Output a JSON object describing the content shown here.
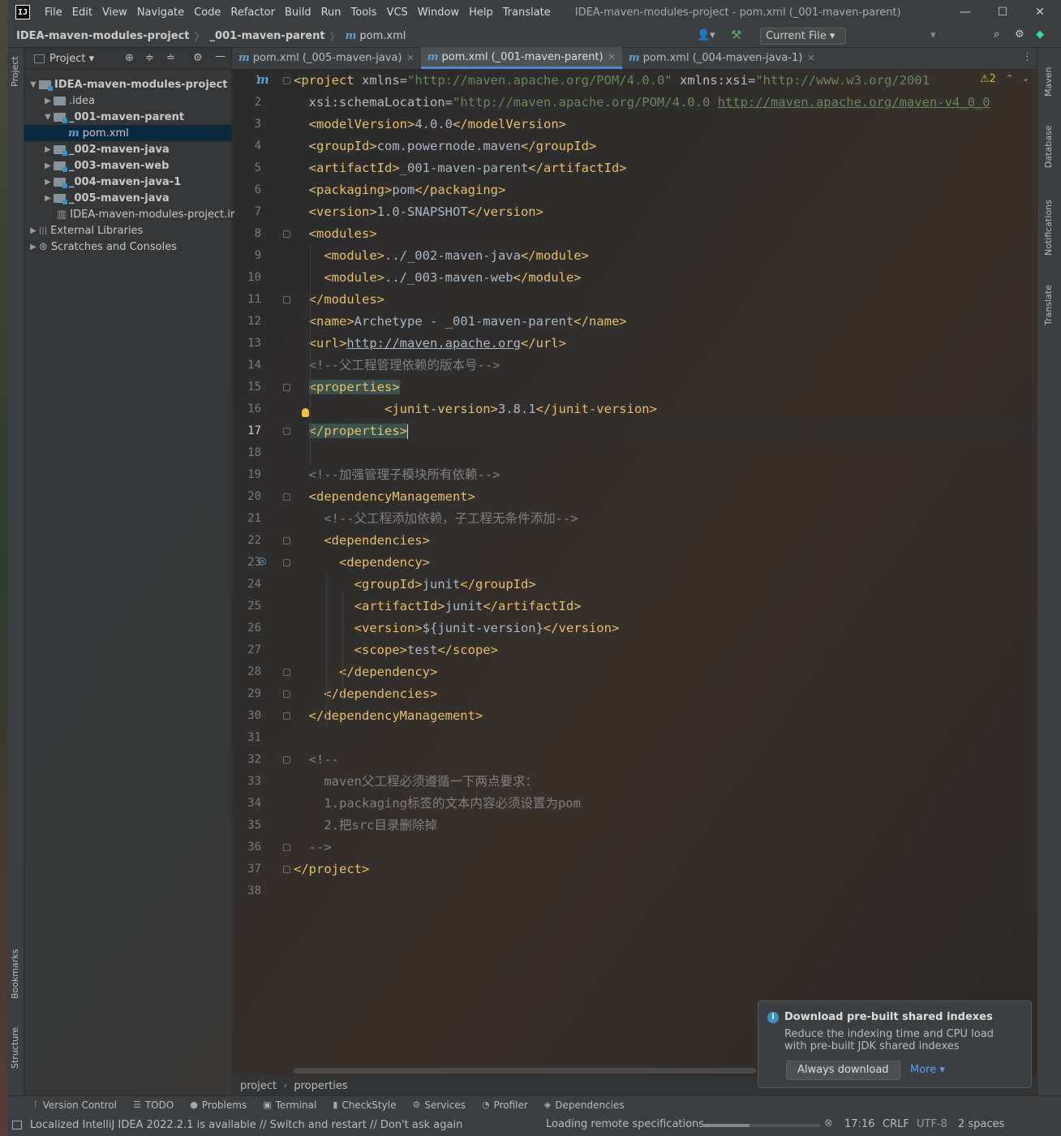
{
  "menu": {
    "items": [
      "File",
      "Edit",
      "View",
      "Navigate",
      "Code",
      "Refactor",
      "Build",
      "Run",
      "Tools",
      "VCS",
      "Window",
      "Help",
      "Translate"
    ],
    "title": "IDEA-maven-modules-project - pom.xml (_001-maven-parent)",
    "app_icon": "IJ"
  },
  "nav": {
    "project": "IDEA-maven-modules-project",
    "module": "_001-maven-parent",
    "file": "pom.xml",
    "run_config": "Current File ▾"
  },
  "project_panel": {
    "title": "Project ▾",
    "tree": [
      {
        "label": "IDEA-maven-modules-project",
        "indent": 0,
        "arrow": "open",
        "kind": "module",
        "bold": true
      },
      {
        "label": ".idea",
        "indent": 1,
        "arrow": "closed",
        "kind": "folder"
      },
      {
        "label": "_001-maven-parent",
        "indent": 1,
        "arrow": "open",
        "kind": "module",
        "bold": true
      },
      {
        "label": "pom.xml",
        "indent": 2,
        "arrow": "none",
        "kind": "maven",
        "selected": true
      },
      {
        "label": "_002-maven-java",
        "indent": 1,
        "arrow": "closed",
        "kind": "module",
        "bold": true
      },
      {
        "label": "_003-maven-web",
        "indent": 1,
        "arrow": "closed",
        "kind": "module",
        "bold": true
      },
      {
        "label": "_004-maven-java-1",
        "indent": 1,
        "arrow": "closed",
        "kind": "module",
        "bold": true
      },
      {
        "label": "_005-maven-java",
        "indent": 1,
        "arrow": "closed",
        "kind": "module",
        "bold": true
      },
      {
        "label": "IDEA-maven-modules-project.ir",
        "indent": 2,
        "arrow": "none",
        "kind": "file"
      },
      {
        "label": "External Libraries",
        "indent": 0,
        "arrow": "closed",
        "kind": "lib"
      },
      {
        "label": "Scratches and Consoles",
        "indent": 0,
        "arrow": "closed",
        "kind": "scratch"
      }
    ]
  },
  "tabs": [
    {
      "label": "pom.xml (_005-maven-java)",
      "active": false
    },
    {
      "label": "pom.xml (_001-maven-parent)",
      "active": true
    },
    {
      "label": "pom.xml (_004-maven-java-1)",
      "active": false
    }
  ],
  "editor": {
    "current_line": 17,
    "warnings": "⚠2",
    "lines": [
      [
        [
          "t",
          "<project "
        ],
        [
          "a",
          "xmlns"
        ],
        [
          "p",
          "="
        ],
        [
          "v",
          "\"http://maven.apache.org/POM/4.0.0\""
        ],
        [
          "p",
          " "
        ],
        [
          "a",
          "xmlns:xsi"
        ],
        [
          "p",
          "="
        ],
        [
          "v",
          "\"http://www.w3.org/2001"
        ]
      ],
      [
        [
          "p",
          "  "
        ],
        [
          "a",
          "xsi:schemaLocation"
        ],
        [
          "p",
          "="
        ],
        [
          "v",
          "\"http://maven.apache.org/POM/4.0.0 "
        ],
        [
          "u",
          "http://maven.apache.org/maven-v4_0_0"
        ]
      ],
      [
        [
          "p",
          "  "
        ],
        [
          "t",
          "<modelVersion>"
        ],
        [
          "p",
          "4.0.0"
        ],
        [
          "t",
          "</modelVersion>"
        ]
      ],
      [
        [
          "p",
          "  "
        ],
        [
          "t",
          "<groupId>"
        ],
        [
          "p",
          "com.powernode.maven"
        ],
        [
          "t",
          "</groupId>"
        ]
      ],
      [
        [
          "p",
          "  "
        ],
        [
          "t",
          "<artifactId>"
        ],
        [
          "p",
          "_001-maven-parent"
        ],
        [
          "t",
          "</artifactId>"
        ]
      ],
      [
        [
          "p",
          "  "
        ],
        [
          "t",
          "<packaging>"
        ],
        [
          "p",
          "pom"
        ],
        [
          "t",
          "</packaging>"
        ]
      ],
      [
        [
          "p",
          "  "
        ],
        [
          "t",
          "<version>"
        ],
        [
          "p",
          "1.0-SNAPSHOT"
        ],
        [
          "t",
          "</version>"
        ]
      ],
      [
        [
          "p",
          "  "
        ],
        [
          "t",
          "<modules>"
        ]
      ],
      [
        [
          "p",
          "    "
        ],
        [
          "t",
          "<module>"
        ],
        [
          "p",
          "../_002-maven-java"
        ],
        [
          "t",
          "</module>"
        ]
      ],
      [
        [
          "p",
          "    "
        ],
        [
          "t",
          "<module>"
        ],
        [
          "p",
          "../_003-maven-web"
        ],
        [
          "t",
          "</module>"
        ]
      ],
      [
        [
          "p",
          "  "
        ],
        [
          "t",
          "</modules>"
        ]
      ],
      [
        [
          "p",
          "  "
        ],
        [
          "t",
          "<name>"
        ],
        [
          "p",
          "Archetype - _001-maven-parent"
        ],
        [
          "t",
          "</name>"
        ]
      ],
      [
        [
          "p",
          "  "
        ],
        [
          "t",
          "<url>"
        ],
        [
          "l",
          "http://maven.apache.org"
        ],
        [
          "t",
          "</url>"
        ]
      ],
      [
        [
          "p",
          "  "
        ],
        [
          "c",
          "<!--父工程管理依赖的版本号-->"
        ]
      ],
      [
        [
          "p",
          "  "
        ],
        [
          "h",
          "<properties>"
        ]
      ],
      [
        [
          "p",
          "            "
        ],
        [
          "t",
          "<junit-version>"
        ],
        [
          "p",
          "3.8.1"
        ],
        [
          "t",
          "</junit-version>"
        ]
      ],
      [
        [
          "p",
          "  "
        ],
        [
          "h",
          "</properties>"
        ]
      ],
      [
        [
          "p",
          ""
        ]
      ],
      [
        [
          "p",
          "  "
        ],
        [
          "c",
          "<!--加强管理子模块所有依赖-->"
        ]
      ],
      [
        [
          "p",
          "  "
        ],
        [
          "t",
          "<dependencyManagement>"
        ]
      ],
      [
        [
          "p",
          "    "
        ],
        [
          "c",
          "<!--父工程添加依赖，子工程无条件添加-->"
        ]
      ],
      [
        [
          "p",
          "    "
        ],
        [
          "t",
          "<dependencies>"
        ]
      ],
      [
        [
          "p",
          "      "
        ],
        [
          "t",
          "<dependency>"
        ]
      ],
      [
        [
          "p",
          "        "
        ],
        [
          "t",
          "<groupId>"
        ],
        [
          "p",
          "junit"
        ],
        [
          "t",
          "</groupId>"
        ]
      ],
      [
        [
          "p",
          "        "
        ],
        [
          "t",
          "<artifactId>"
        ],
        [
          "p",
          "junit"
        ],
        [
          "t",
          "</artifactId>"
        ]
      ],
      [
        [
          "p",
          "        "
        ],
        [
          "t",
          "<version>"
        ],
        [
          "p",
          "${junit-version}"
        ],
        [
          "t",
          "</version>"
        ]
      ],
      [
        [
          "p",
          "        "
        ],
        [
          "t",
          "<scope>"
        ],
        [
          "p",
          "test"
        ],
        [
          "t",
          "</scope>"
        ]
      ],
      [
        [
          "p",
          "      "
        ],
        [
          "t",
          "</dependency>"
        ]
      ],
      [
        [
          "p",
          "    "
        ],
        [
          "t",
          "</dependencies>"
        ]
      ],
      [
        [
          "p",
          "  "
        ],
        [
          "t",
          "</dependencyManagement>"
        ]
      ],
      [
        [
          "p",
          ""
        ]
      ],
      [
        [
          "p",
          "  "
        ],
        [
          "c",
          "<!--"
        ]
      ],
      [
        [
          "p",
          "    "
        ],
        [
          "c",
          "maven父工程必须遵循一下两点要求："
        ]
      ],
      [
        [
          "p",
          "    "
        ],
        [
          "c",
          "1.packaging标签的文本内容必须设置为pom"
        ]
      ],
      [
        [
          "p",
          "    "
        ],
        [
          "c",
          "2.把src目录删除掉"
        ]
      ],
      [
        [
          "p",
          "  "
        ],
        [
          "c",
          "-->"
        ]
      ],
      [
        [
          "t",
          "</project>"
        ]
      ],
      [
        [
          "p",
          ""
        ]
      ]
    ]
  },
  "right_strip": [
    "Maven",
    "Database",
    "Notifications",
    "Translate"
  ],
  "left_strip": [
    "Project",
    "Bookmarks",
    "Structure"
  ],
  "breadcrumb": [
    "project",
    "properties"
  ],
  "tool_windows": [
    {
      "icon": "ᚴ",
      "label": "Version Control"
    },
    {
      "icon": "☰",
      "label": "TODO"
    },
    {
      "icon": "●",
      "label": "Problems"
    },
    {
      "icon": "▣",
      "label": "Terminal"
    },
    {
      "icon": "▮",
      "label": "CheckStyle"
    },
    {
      "icon": "⚙",
      "label": "Services"
    },
    {
      "icon": "◔",
      "label": "Profiler"
    },
    {
      "icon": "◈",
      "label": "Dependencies"
    }
  ],
  "status": {
    "message": "Localized IntelliJ IDEA 2022.2.1 is available // Switch and restart // Don't ask again",
    "loading": "Loading remote specifications",
    "position": "17:16",
    "line_sep": "CRLF",
    "encoding": "UTF-8",
    "indent": "2 spaces"
  },
  "notification": {
    "title": "Download pre-built shared indexes",
    "body1": "Reduce the indexing time and CPU load",
    "body2": "with pre-built JDK shared indexes",
    "primary": "Always download",
    "more": "More ▾"
  }
}
